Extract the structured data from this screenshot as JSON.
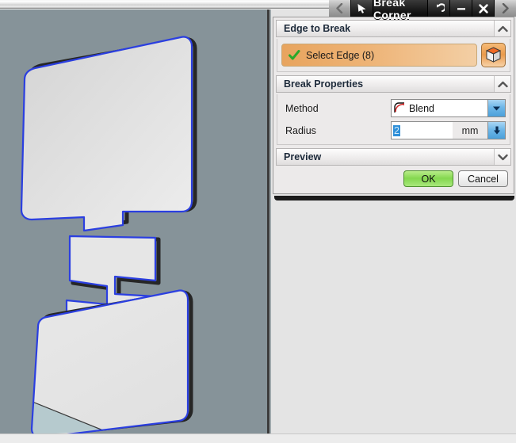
{
  "window": {
    "title": "Break Corner",
    "buttons": [
      {
        "name": "back-arrow",
        "icon": "chevron-left-icon",
        "state": "disabled"
      },
      {
        "name": "pointer-tool",
        "icon": "arrow-cursor-icon",
        "state": "normal"
      },
      {
        "name": "reset",
        "icon": "undo-arrow-icon",
        "state": "normal"
      },
      {
        "name": "minimize",
        "icon": "minimize-icon",
        "state": "normal"
      },
      {
        "name": "close",
        "icon": "close-x-icon",
        "state": "normal"
      },
      {
        "name": "forward-arrow",
        "icon": "chevron-right-icon",
        "state": "normal"
      }
    ]
  },
  "dialog": {
    "sections": [
      {
        "id": "edge-to-break",
        "title": "Edge to Break",
        "collapse_icon": "chevron-up-icon",
        "expanded": true,
        "select_edge": {
          "label": "Select Edge (8)",
          "status_icon": "green-check-icon",
          "picker_icon": "cube-icon"
        }
      },
      {
        "id": "break-properties",
        "title": "Break Properties",
        "collapse_icon": "chevron-up-icon",
        "expanded": true,
        "fields": [
          {
            "id": "method",
            "label": "Method",
            "type": "combobox",
            "value": "Blend",
            "icon": "blend-fillet-icon",
            "arrow_icon": "chevron-down-icon"
          },
          {
            "id": "radius",
            "label": "Radius",
            "type": "spinner",
            "value": "2",
            "unit": "mm",
            "selected": true,
            "arrow_icon": "arrow-down-icon"
          }
        ]
      },
      {
        "id": "preview",
        "title": "Preview",
        "collapse_icon": "chevron-down-icon",
        "expanded": false
      }
    ],
    "footer": {
      "ok_label": "OK",
      "cancel_label": "Cancel"
    }
  },
  "viewport": {
    "background_color": "#869399",
    "face_color": "#e5e5e5",
    "selected_edge_color": "#2b3fe0",
    "corner_edge_color": "#262626",
    "shaded_face_color": "#b6cace"
  }
}
